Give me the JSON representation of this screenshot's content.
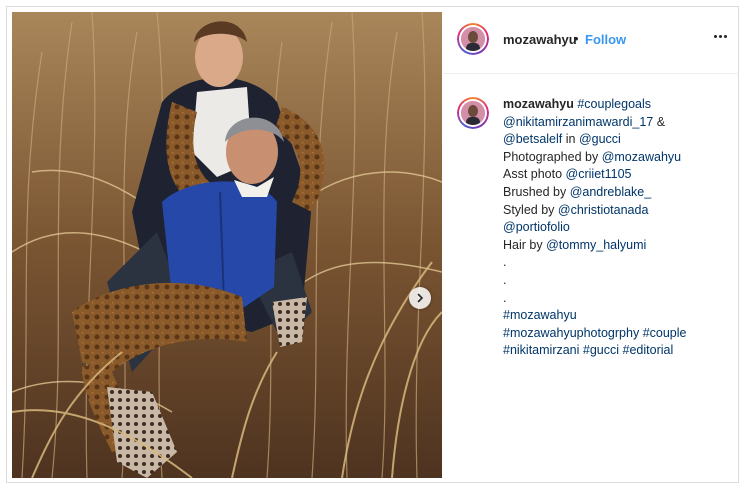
{
  "post": {
    "username": "mozawahyu",
    "separator": "•",
    "follow_label": "Follow",
    "more_icon": "more-horizontal-icon",
    "next_icon": "chevron-right-icon"
  },
  "caption": {
    "username": "mozawahyu",
    "first_tag": "#couplegoals",
    "lines": [
      {
        "parts": [
          {
            "t": "@nikitamirzanimawardi_17",
            "c": "tag"
          },
          {
            "t": " &",
            "c": "txt"
          }
        ]
      },
      {
        "parts": [
          {
            "t": "@betsalelf",
            "c": "tag"
          },
          {
            "t": " in ",
            "c": "txt"
          },
          {
            "t": "@gucci",
            "c": "tag"
          }
        ]
      },
      {
        "parts": [
          {
            "t": "Photographed by ",
            "c": "txt"
          },
          {
            "t": "@mozawahyu",
            "c": "tag"
          }
        ]
      },
      {
        "parts": [
          {
            "t": "Asst photo ",
            "c": "txt"
          },
          {
            "t": "@criiet1105",
            "c": "tag"
          }
        ]
      },
      {
        "parts": [
          {
            "t": "Brushed by ",
            "c": "txt"
          },
          {
            "t": "@andreblake_",
            "c": "tag"
          }
        ]
      },
      {
        "parts": [
          {
            "t": "Styled by ",
            "c": "txt"
          },
          {
            "t": "@christiotanada",
            "c": "tag"
          }
        ]
      },
      {
        "parts": [
          {
            "t": "@portiofolio",
            "c": "tag"
          }
        ]
      },
      {
        "parts": [
          {
            "t": "Hair by ",
            "c": "txt"
          },
          {
            "t": "@tommy_halyumi",
            "c": "tag"
          }
        ]
      },
      {
        "parts": [
          {
            "t": ".",
            "c": "txt"
          }
        ]
      },
      {
        "parts": [
          {
            "t": ".",
            "c": "txt"
          }
        ]
      },
      {
        "parts": [
          {
            "t": ".",
            "c": "txt"
          }
        ]
      },
      {
        "parts": [
          {
            "t": "#mozawahyu",
            "c": "tag"
          }
        ]
      },
      {
        "parts": [
          {
            "t": "#mozawahyuphotogrphy",
            "c": "tag"
          },
          {
            "t": " ",
            "c": "txt"
          },
          {
            "t": "#couple",
            "c": "tag"
          }
        ]
      },
      {
        "parts": [
          {
            "t": "#nikitamirzani",
            "c": "tag"
          },
          {
            "t": " ",
            "c": "txt"
          },
          {
            "t": "#gucci",
            "c": "tag"
          },
          {
            "t": " ",
            "c": "txt"
          },
          {
            "t": "#editorial",
            "c": "tag"
          }
        ]
      }
    ]
  },
  "colors": {
    "link": "#003569",
    "follow": "#3897f0",
    "border": "#dbdbdb",
    "text": "#262626"
  }
}
